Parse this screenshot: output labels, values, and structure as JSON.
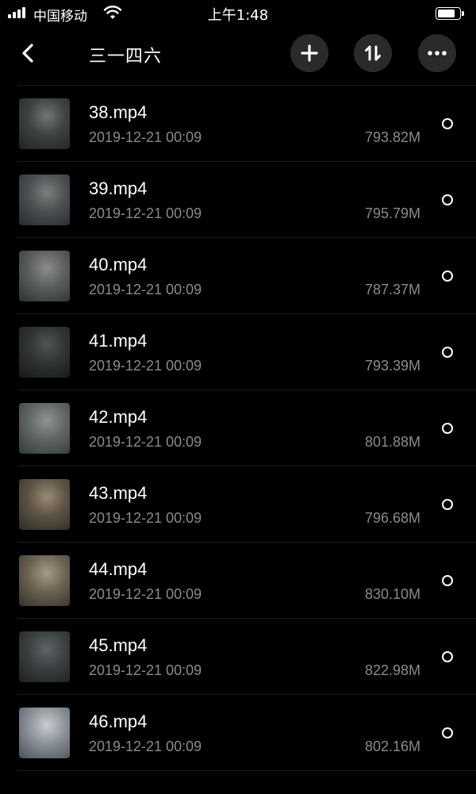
{
  "status_bar": {
    "carrier": "中国移动",
    "time": "上午1:48",
    "battery_level": 0.8,
    "signal_icon": "signal-bars-icon",
    "wifi_icon": "wifi-icon",
    "battery_icon": "battery-icon"
  },
  "nav": {
    "title": "三一四六",
    "back_icon": "chevron-left-icon",
    "add_icon": "plus-icon",
    "sort_icon": "sort-arrows-icon",
    "more_icon": "more-dots-icon"
  },
  "files": [
    {
      "name": "38.mp4",
      "date": "2019-12-21 00:09",
      "size": "793.82M",
      "thumb_colors": [
        "#6f7772",
        "#3c423f",
        "#1f2321"
      ]
    },
    {
      "name": "39.mp4",
      "date": "2019-12-21 00:09",
      "size": "795.79M",
      "thumb_colors": [
        "#7b7f7d",
        "#4a4f51",
        "#272a2c"
      ]
    },
    {
      "name": "40.mp4",
      "date": "2019-12-21 00:09",
      "size": "787.37M",
      "thumb_colors": [
        "#8a8c88",
        "#5a5e5a",
        "#2e3230"
      ]
    },
    {
      "name": "41.mp4",
      "date": "2019-12-21 00:09",
      "size": "793.39M",
      "thumb_colors": [
        "#505452",
        "#2f3332",
        "#161918"
      ]
    },
    {
      "name": "42.mp4",
      "date": "2019-12-21 00:09",
      "size": "801.88M",
      "thumb_colors": [
        "#8e948f",
        "#5f6661",
        "#333835"
      ]
    },
    {
      "name": "43.mp4",
      "date": "2019-12-21 00:09",
      "size": "796.68M",
      "thumb_colors": [
        "#9a8a72",
        "#5c5345",
        "#2e2a24"
      ]
    },
    {
      "name": "44.mp4",
      "date": "2019-12-21 00:09",
      "size": "830.10M",
      "thumb_colors": [
        "#a79a83",
        "#6a6251",
        "#35312a"
      ]
    },
    {
      "name": "45.mp4",
      "date": "2019-12-21 00:09",
      "size": "822.98M",
      "thumb_colors": [
        "#5e6566",
        "#3a3f40",
        "#1d2021"
      ]
    },
    {
      "name": "46.mp4",
      "date": "2019-12-21 00:09",
      "size": "802.16M",
      "thumb_colors": [
        "#c7cdd2",
        "#8a9097",
        "#4a4f55"
      ]
    }
  ]
}
